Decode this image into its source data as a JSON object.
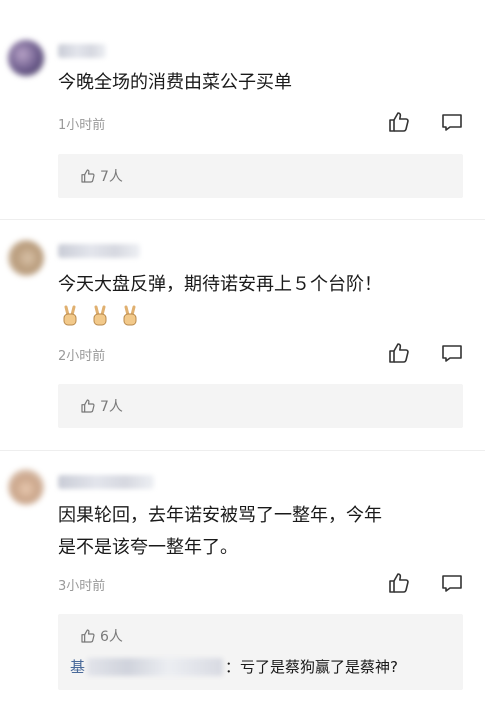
{
  "comments": [
    {
      "text": "今晚全场的消费由菜公子买单",
      "time": "1小时前",
      "likes": "7人"
    },
    {
      "text": "今天大盘反弹，期待诺安再上５个台阶！",
      "time": "2小时前",
      "likes": "7人",
      "emojis": [
        "victory-hand",
        "victory-hand",
        "victory-hand"
      ]
    },
    {
      "text_line1": "因果轮回，去年诺安被骂了一整年，今年",
      "text_line2": "是不是该夸一整年了。",
      "time": "3小时前",
      "likes": "6人",
      "reply": {
        "name_prefix": "基",
        "text": "：亏了是蔡狗赢了是蔡神?"
      }
    }
  ],
  "icons": {
    "like": "thumbs-up-outline",
    "comment": "speech-bubble-outline"
  },
  "colors": {
    "text": "#1a1a1a",
    "muted": "#9a9a9a",
    "panel": "#f4f4f4",
    "link": "#4a6a9a"
  }
}
